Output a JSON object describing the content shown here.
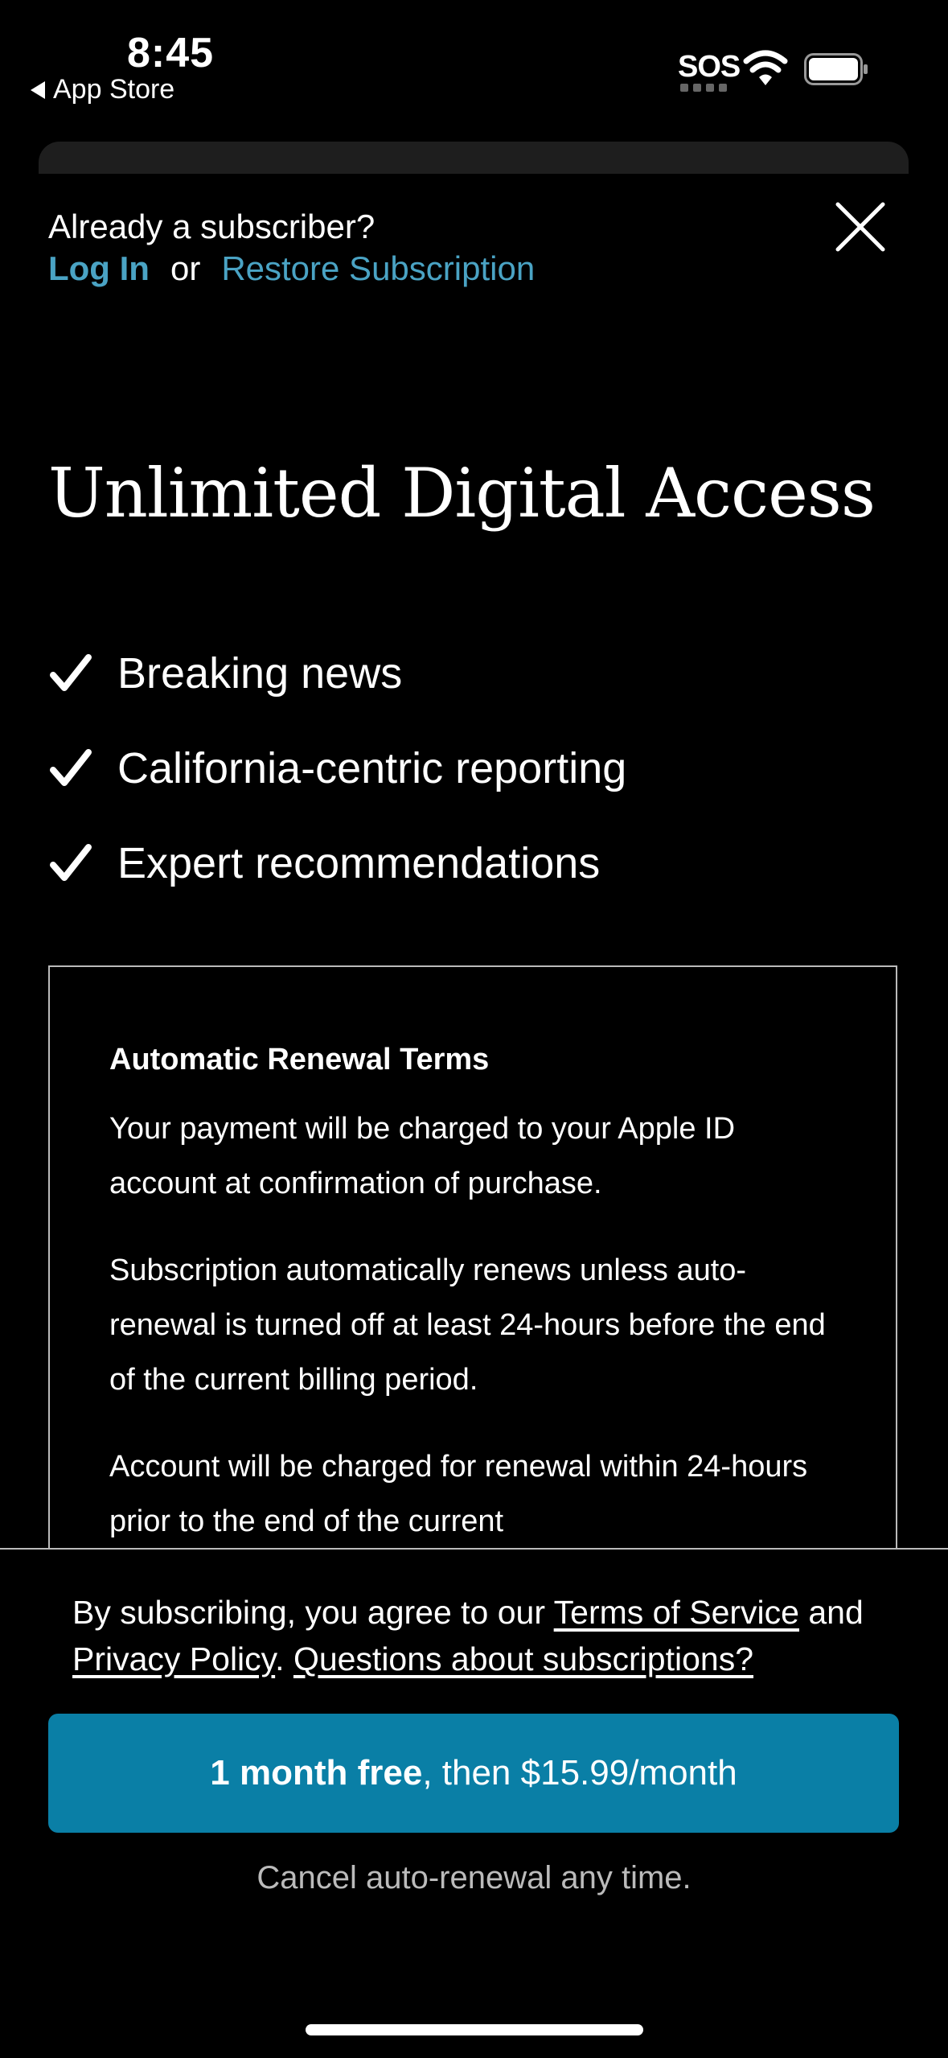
{
  "status": {
    "time": "8:45",
    "back_app": "App Store",
    "sos": "SOS"
  },
  "header": {
    "already": "Already a subscriber?",
    "login": "Log In",
    "or": "or",
    "restore": "Restore Subscription"
  },
  "title": "Unlimited Digital Access",
  "features": [
    "Breaking news",
    "California-centric reporting",
    "Expert recommendations"
  ],
  "terms": {
    "heading": "Automatic Renewal Terms",
    "p1": "Your payment will be charged to your Apple ID account at confirmation of purchase.",
    "p2": "Subscription automatically renews unless auto-renewal is turned off at least 24-hours before the end of the current billing period.",
    "p3": "Account will be charged for renewal within 24-hours prior to the end of the current"
  },
  "agree": {
    "prefix": "By subscribing, you agree to our ",
    "tos": "Terms of Service",
    "and": " and ",
    "privacy": "Privacy Policy",
    "dot": ". ",
    "questions": "Questions about subscriptions?"
  },
  "cta": {
    "bold": "1 month free",
    "rest": ", then $15.99/month"
  },
  "cancel_note": "Cancel auto-renewal any time.",
  "colors": {
    "accent_link": "#4aa3c4",
    "cta_bg": "#0a7fa6",
    "background": "#000000"
  }
}
